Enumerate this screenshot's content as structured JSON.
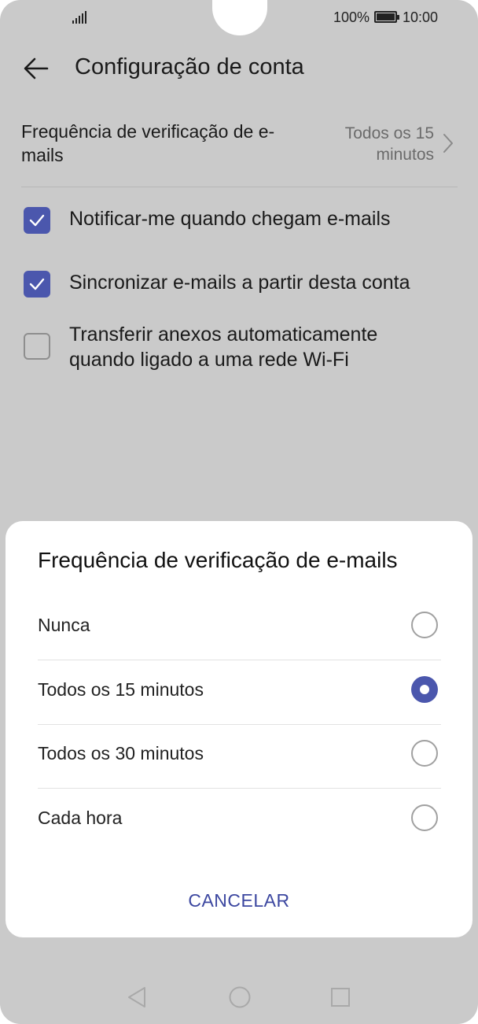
{
  "status_bar": {
    "battery_percent": "100%",
    "time": "10:00",
    "icons": [
      "signal-icon",
      "battery-icon"
    ]
  },
  "app_bar": {
    "title": "Configuração de conta",
    "back_icon": "arrow-left-icon"
  },
  "settings": {
    "frequency": {
      "label": "Frequência de verificação de e-mails",
      "value": "Todos os 15 minutos",
      "icon": "chevron-right-icon"
    },
    "options": [
      {
        "label": "Notificar-me quando chegam e-mails",
        "checked": true
      },
      {
        "label": "Sincronizar e-mails a partir desta conta",
        "checked": true
      },
      {
        "label": "Transferir anexos automaticamente quando ligado a uma rede Wi-Fi",
        "checked": false
      }
    ]
  },
  "dialog": {
    "title": "Frequência de verificação de e-mails",
    "choices": [
      {
        "label": "Nunca",
        "selected": false
      },
      {
        "label": "Todos os 15 minutos",
        "selected": true
      },
      {
        "label": "Todos os 30 minutos",
        "selected": false
      },
      {
        "label": "Cada hora",
        "selected": false
      }
    ],
    "cancel_label": "CANCELAR"
  },
  "nav_bar": {
    "icons": [
      "nav-back-icon",
      "nav-home-icon",
      "nav-recents-icon"
    ]
  },
  "colors": {
    "accent": "#4b57ad",
    "scrim_background": "#cacaca",
    "dialog_background": "#ffffff"
  }
}
